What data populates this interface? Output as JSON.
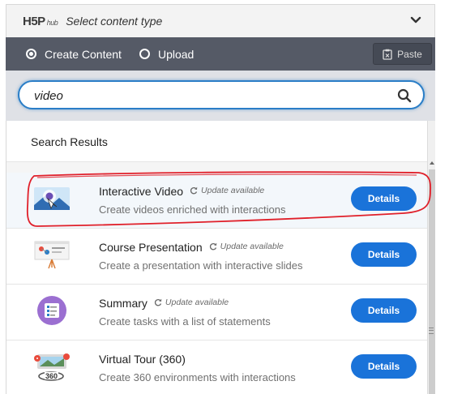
{
  "header": {
    "logo": "H5P",
    "logo_sub": "hub",
    "title": "Select content type"
  },
  "tabs": [
    {
      "label": "Create Content",
      "selected": true
    },
    {
      "label": "Upload",
      "selected": false
    }
  ],
  "paste": {
    "label": "Paste"
  },
  "search": {
    "value": "video"
  },
  "results": {
    "heading": "Search Results",
    "items": [
      {
        "title": "Interactive Video",
        "update": "Update available",
        "description": "Create videos enriched with interactions",
        "button": "Details",
        "icon": "interactive-video-icon"
      },
      {
        "title": "Course Presentation",
        "update": "Update available",
        "description": "Create a presentation with interactive slides",
        "button": "Details",
        "icon": "course-presentation-icon"
      },
      {
        "title": "Summary",
        "update": "Update available",
        "description": "Create tasks with a list of statements",
        "button": "Details",
        "icon": "summary-icon"
      },
      {
        "title": "Virtual Tour (360)",
        "update": "",
        "description": "Create 360 environments with interactions",
        "button": "Details",
        "icon": "virtual-tour-icon"
      }
    ]
  },
  "colors": {
    "accent": "#1a73d9",
    "tab_bar": "#555a66",
    "annotation": "#e0202a"
  }
}
